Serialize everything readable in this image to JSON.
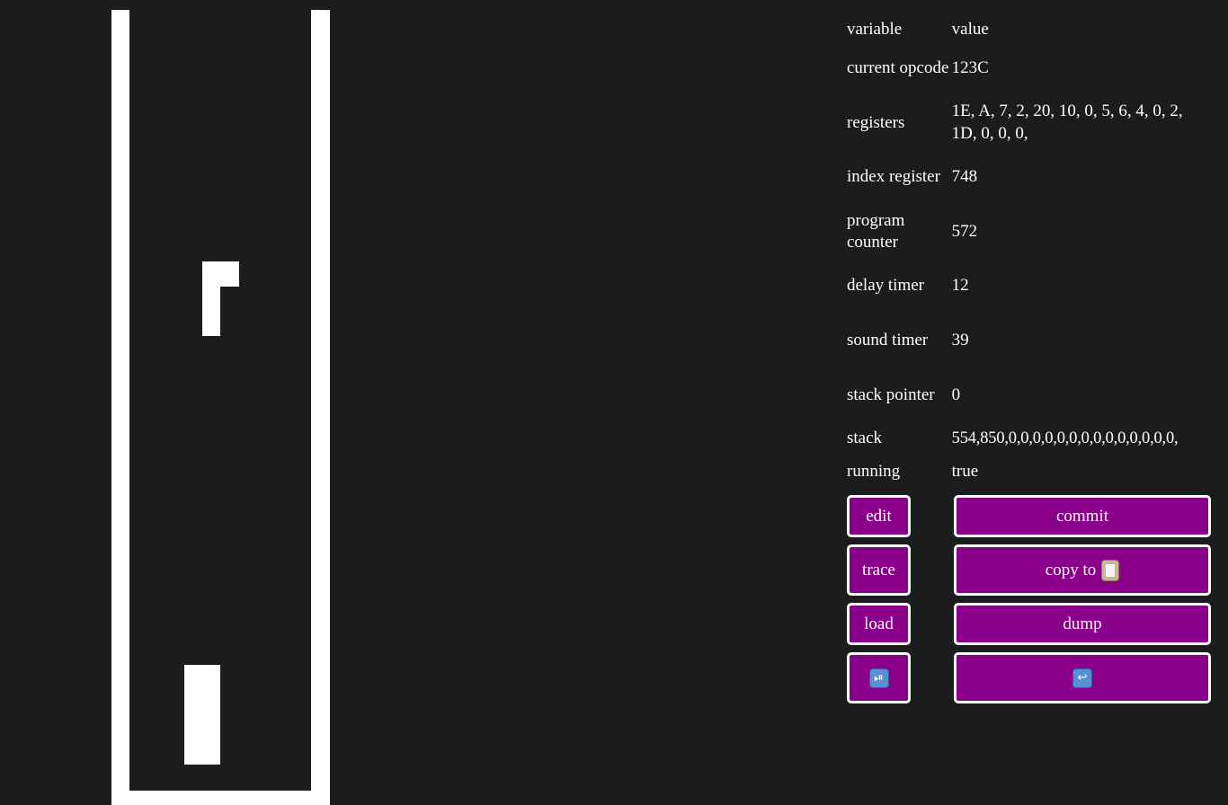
{
  "table": {
    "header": {
      "name": "variable",
      "value": "value"
    },
    "rows": [
      {
        "name": "current opcode",
        "value": "123C"
      },
      {
        "name": "registers",
        "value": "1E, A, 7, 2, 20, 10, 0, 5, 6, 4, 0, 2, 1D, 0, 0, 0,"
      },
      {
        "name": "index register",
        "value": "748"
      },
      {
        "name": "program counter",
        "value": "572"
      },
      {
        "name": "delay timer",
        "value": "12"
      },
      {
        "name": "sound timer",
        "value": "39"
      },
      {
        "name": "stack pointer",
        "value": "0"
      },
      {
        "name": "stack",
        "value": "554,850,0,0,0,0,0,0,0,0,0,0,0,0,0,0,"
      },
      {
        "name": "running",
        "value": "true"
      }
    ]
  },
  "buttons": {
    "edit": "edit",
    "commit": "commit",
    "trace": "trace",
    "copy": "copy to",
    "load": "load",
    "dump": "dump",
    "play_pause_icon": "play-pause-icon",
    "undo_icon": "return-arrow-icon",
    "clipboard_icon": "clipboard-icon",
    "accent_color": "#8b008b"
  },
  "display": {
    "background": "#1b1c1e",
    "pixel_color": "#ffffff"
  }
}
